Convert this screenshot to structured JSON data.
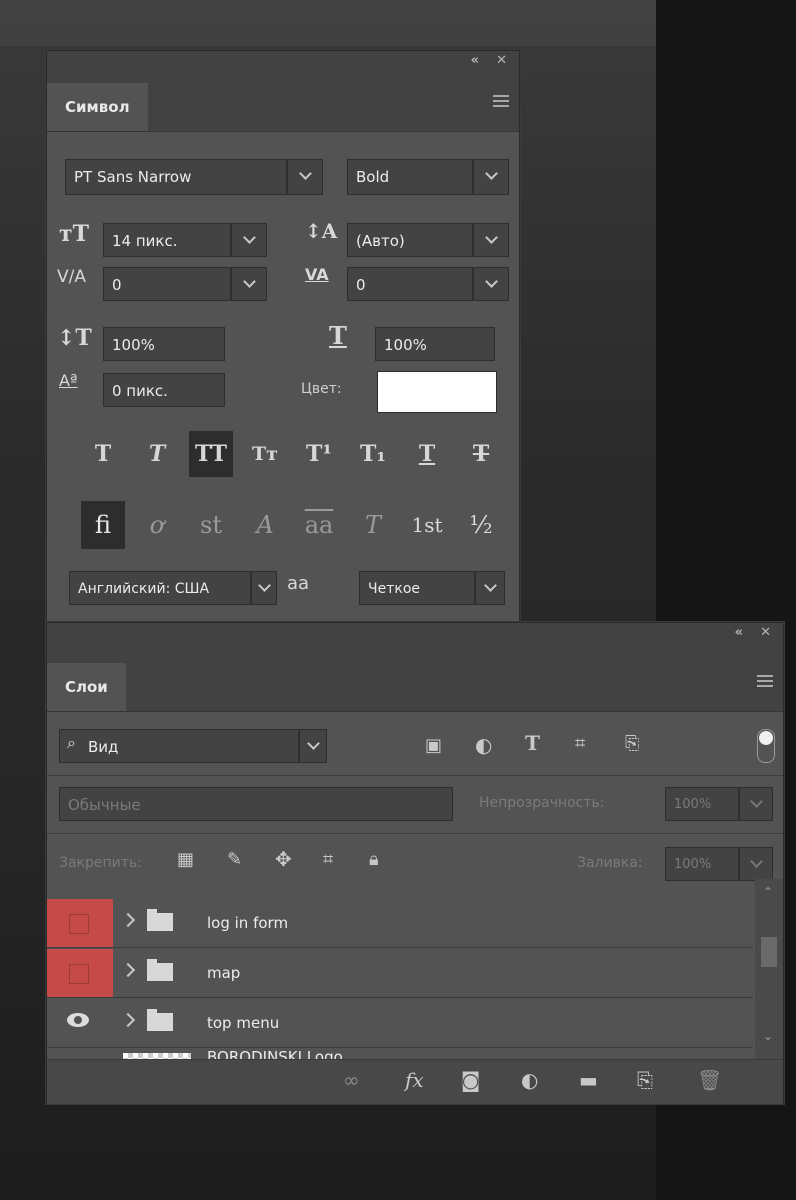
{
  "symbol_panel": {
    "tab": "Символ",
    "font_family": "PT Sans Narrow",
    "font_style": "Bold",
    "font_size": "14 пикс.",
    "leading": "(Авто)",
    "kerning": "0",
    "tracking": "0",
    "vertical_scale": "100%",
    "horizontal_scale": "100%",
    "baseline_shift": "0 пикс.",
    "color_label": "Цвет:",
    "color_value": "#ffffff",
    "language": "Английский: США",
    "antialias_glyph": "aa",
    "antialias": "Четкое",
    "style_buttons": [
      "T",
      "T",
      "TT",
      "Tт",
      "T¹",
      "T₁",
      "T",
      "T"
    ],
    "opentype_buttons": [
      "fi",
      "ơ",
      "st",
      "A",
      "aa",
      "T",
      "1st",
      "½"
    ]
  },
  "layers_panel": {
    "tab": "Слои",
    "filter_label": "Вид",
    "blend_mode": "Обычные",
    "opacity_label": "Непрозрачность:",
    "opacity_value": "100%",
    "lock_label": "Закрепить:",
    "fill_label": "Заливка:",
    "fill_value": "100%",
    "layers": [
      {
        "name": "log in form",
        "visible": false
      },
      {
        "name": "map",
        "visible": false
      },
      {
        "name": "top menu",
        "visible": true
      },
      {
        "name": "BORODINSKI Logo",
        "visible": true
      }
    ],
    "bottom_icons": [
      "link-icon",
      "fx-icon",
      "mask-icon",
      "adjustment-icon",
      "group-icon",
      "new-layer-icon",
      "delete-icon"
    ]
  }
}
